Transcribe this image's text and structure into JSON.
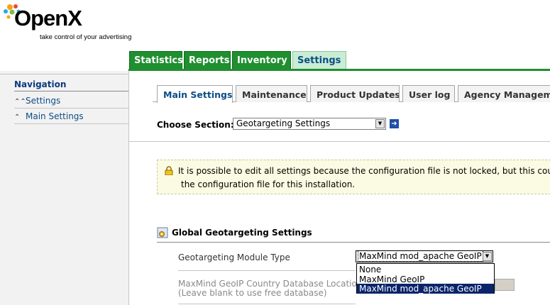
{
  "logo": {
    "word": "OpenX",
    "tagline": "take control of your advertising"
  },
  "top_tabs": [
    {
      "label": "Statistics"
    },
    {
      "label": "Reports"
    },
    {
      "label": "Inventory"
    },
    {
      "label": "Settings"
    }
  ],
  "navigation": {
    "title": "Navigation",
    "items": [
      {
        "label": "Settings",
        "icon": "double-chevron-up-icon"
      },
      {
        "label": "Main Settings",
        "icon": "chevron-up-icon"
      }
    ]
  },
  "sub_tabs": [
    {
      "label": "Main Settings"
    },
    {
      "label": "Maintenance"
    },
    {
      "label": "Product Updates"
    },
    {
      "label": "User log"
    },
    {
      "label": "Agency Manageme"
    }
  ],
  "choose_section": {
    "label": "Choose Section:",
    "value": "Geotargeting Settings"
  },
  "warning": {
    "line1": "It is possible to edit all settings because the configuration file is not locked, but this could lea",
    "line2": "the configuration file for this installation."
  },
  "global_settings": {
    "title": "Global Geotargeting Settings",
    "module_type_label": "Geotargeting Module Type",
    "module_type_value": "MaxMind mod_apache GeoIP",
    "module_options": [
      "None",
      "MaxMind GeoIP",
      "MaxMind mod_apache GeoIP"
    ],
    "db_location_label_line1": "MaxMind GeoIP Country Database Location",
    "db_location_label_line2": "(Leave blank to use free database)"
  },
  "colors": {
    "tab_green": "#1f8f2f",
    "tab_active": "#c9ecd4",
    "link_blue": "#0b4d86",
    "selection_blue": "#0a246a",
    "warning_bg": "#fbfbe3"
  }
}
